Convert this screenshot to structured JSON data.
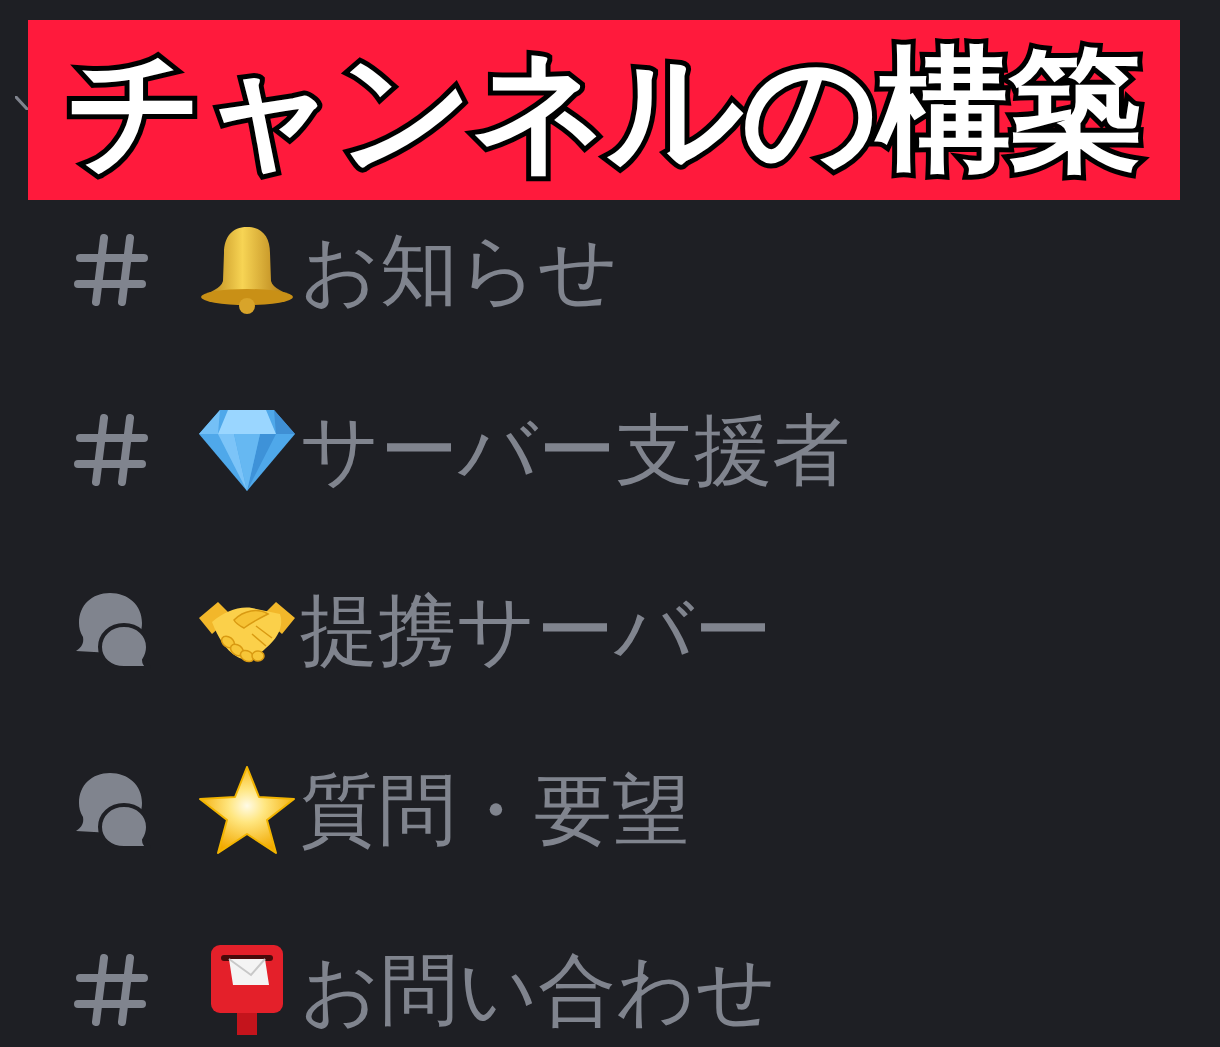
{
  "title": "チャンネルの構築",
  "channels": [
    {
      "kind": "text",
      "name": "お知らせ"
    },
    {
      "kind": "text",
      "name": "サーバー支援者"
    },
    {
      "kind": "forum",
      "name": "提携サーバー"
    },
    {
      "kind": "forum",
      "name": "質問・要望"
    },
    {
      "kind": "text",
      "name": "お問い合わせ"
    }
  ]
}
